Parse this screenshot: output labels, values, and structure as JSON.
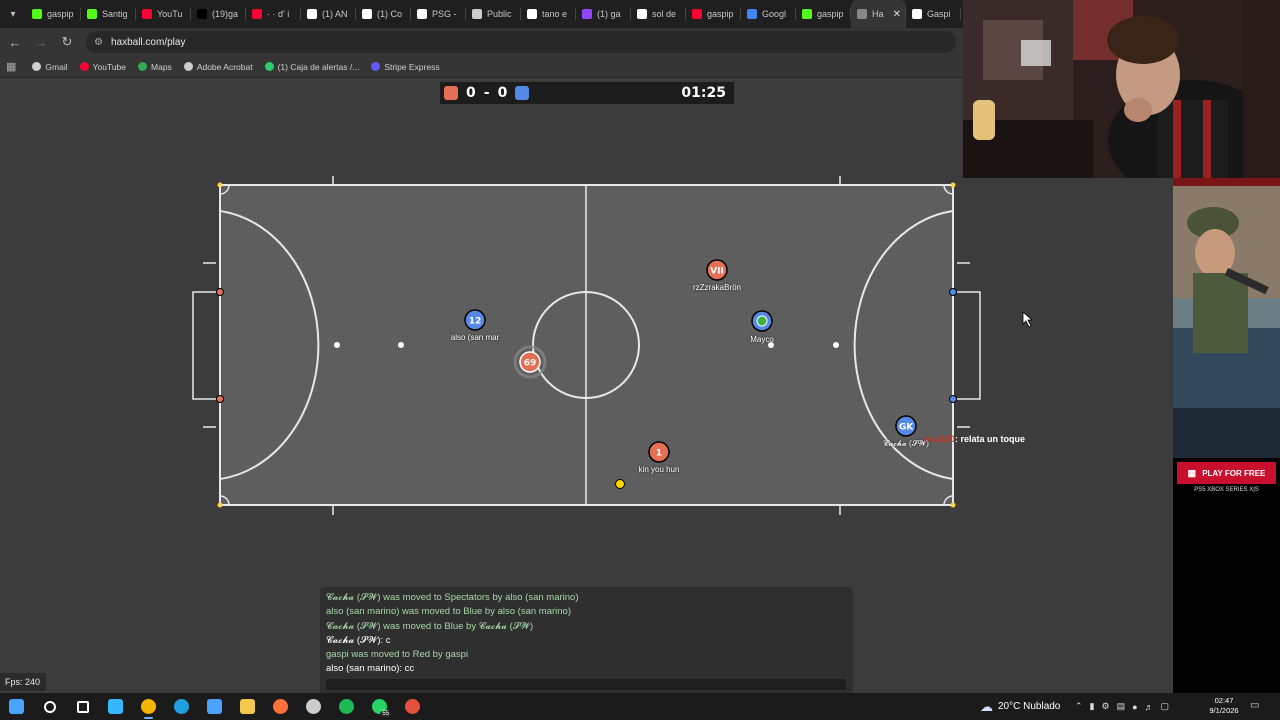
{
  "browser": {
    "tabs": [
      {
        "label": "gaspip",
        "color": "#53fc18"
      },
      {
        "label": "Santig",
        "color": "#53fc18"
      },
      {
        "label": "YouTu",
        "color": "#ff0033"
      },
      {
        "label": "(19)ga",
        "color": "#000000"
      },
      {
        "label": "· · d' i",
        "color": "#ff0033"
      },
      {
        "label": "(1) AN",
        "color": "#ffffff"
      },
      {
        "label": "(1) Co",
        "color": "#ffffff"
      },
      {
        "label": "PSG -",
        "color": "#ffffff"
      },
      {
        "label": "Public",
        "color": "#cccccc"
      },
      {
        "label": "tano e",
        "color": "#ffffff"
      },
      {
        "label": "(1) ga",
        "color": "#9146ff"
      },
      {
        "label": "sol de",
        "color": "#ffffff"
      },
      {
        "label": "gaspip",
        "color": "#ff0033"
      },
      {
        "label": "Googl",
        "color": "#4285f4"
      },
      {
        "label": "gaspip",
        "color": "#53fc18"
      },
      {
        "label": "Ha",
        "color": "#888888",
        "active": true,
        "close": "✕"
      },
      {
        "label": "Gaspi",
        "color": "#ffffff"
      }
    ],
    "url": "haxball.com/play",
    "bookmarks": [
      {
        "label": "Gmail",
        "color": "#d0d0d0"
      },
      {
        "label": "YouTube",
        "color": "#ff0033"
      },
      {
        "label": "Maps",
        "color": "#34a853"
      },
      {
        "label": "Adobe Acrobat",
        "color": "#cccccc"
      },
      {
        "label": "(1) Caja de alertas /...",
        "color": "#2ecc71"
      },
      {
        "label": "Stripe Express",
        "color": "#635bff"
      }
    ]
  },
  "game": {
    "score_red": "0",
    "score_sep": "-",
    "score_blue": "0",
    "timer": "01:25",
    "red_color": "#e56e56",
    "blue_color": "#5689e5",
    "players": [
      {
        "team": "red",
        "number": "VII",
        "name": "rzZzrakaBrön"
      },
      {
        "team": "blue",
        "number": "12",
        "name": "also (san mar"
      },
      {
        "team": "blue",
        "number": "◉",
        "name": "Mayco"
      },
      {
        "team": "red",
        "number": "69",
        "name": ""
      },
      {
        "team": "red",
        "number": "1",
        "name": "kin you hun"
      },
      {
        "team": "blue",
        "number": "GK",
        "name": "𝓒𝓪𝓬𝓱𝓪 (𝓢𝓦)"
      }
    ],
    "bubble": {
      "who": "edu190",
      "text": ": relata un toque"
    },
    "chat": [
      {
        "text": "𝓒𝓪𝓬𝓱𝓪 (𝓢𝓦) was moved to Spectators by also (san marino)",
        "sys": true
      },
      {
        "text": "also (san marino) was moved to Blue by also (san marino)",
        "sys": true
      },
      {
        "text": "𝓒𝓪𝓬𝓱𝓪 (𝓢𝓦) was moved to Blue by 𝓒𝓪𝓬𝓱𝓪 (𝓢𝓦)",
        "sys": true
      },
      {
        "text": "𝓒𝓪𝓬𝓱𝓪 (𝓢𝓦): c",
        "sys": false
      },
      {
        "text": "gaspi was moved to Red by gaspi",
        "sys": true
      },
      {
        "text": "also (san marino): cc",
        "sys": false
      }
    ],
    "fps": "Fps: 240"
  },
  "ad": {
    "button": "PLAY FOR FREE",
    "platforms": "PS5   XBOX SERIES X|S"
  },
  "taskbar": {
    "icons": [
      {
        "name": "start-icon",
        "color": "#4aa3ff"
      },
      {
        "name": "search-icon",
        "color": "#ffffff"
      },
      {
        "name": "task-view-icon",
        "color": "#ffffff"
      },
      {
        "name": "copilot-icon",
        "color": "#35b8ff"
      },
      {
        "name": "chrome-icon",
        "color": "#f4b400",
        "active": true
      },
      {
        "name": "edge-icon",
        "color": "#1fa0e0"
      },
      {
        "name": "store-icon",
        "color": "#4aa3ff"
      },
      {
        "name": "explorer-icon",
        "color": "#f2c94c"
      },
      {
        "name": "firefox-icon",
        "color": "#ff7139"
      },
      {
        "name": "obs-icon",
        "color": "#cccccc"
      },
      {
        "name": "spotify-icon",
        "color": "#1db954"
      },
      {
        "name": "whatsapp-icon",
        "color": "#25d366",
        "badge": "55"
      },
      {
        "name": "app-icon",
        "color": "#e5503c"
      }
    ],
    "weather": "20°C  Nublado",
    "time": "02:47",
    "date": "9/1/2026"
  }
}
